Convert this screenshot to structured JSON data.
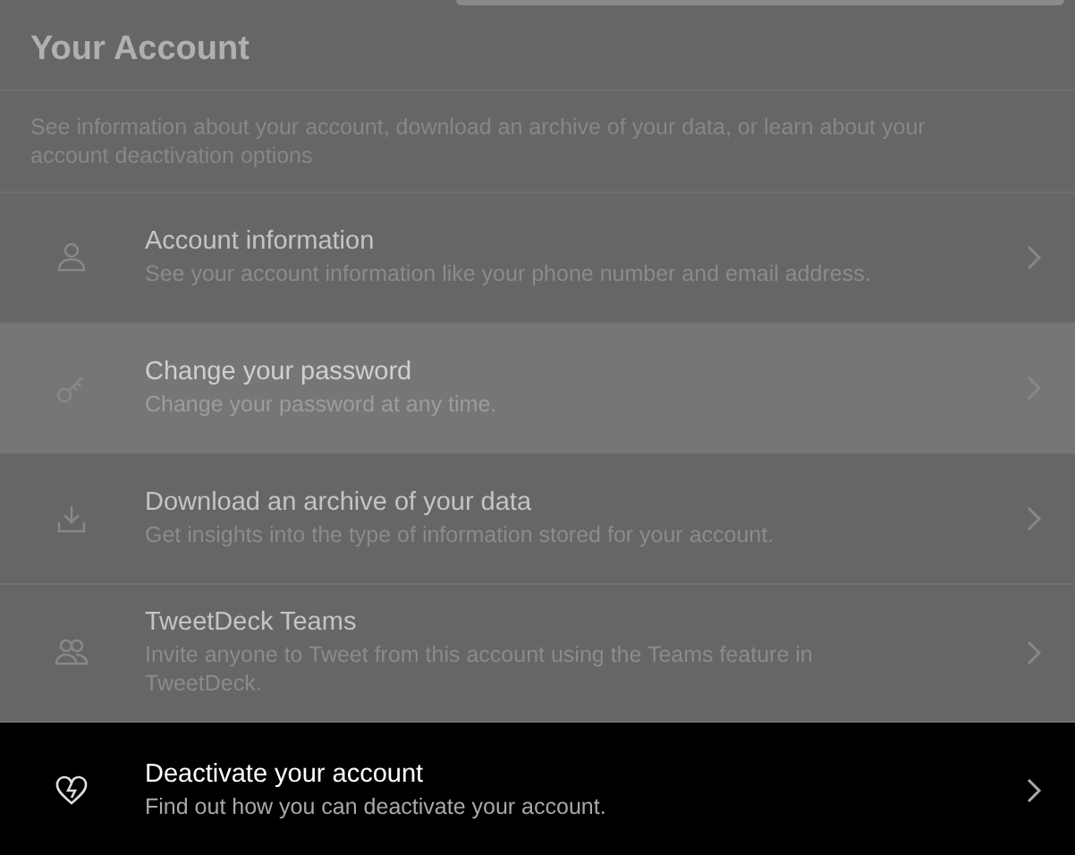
{
  "header": {
    "title": "Your Account",
    "description": "See information about your account, download an archive of your data, or learn about your account deactivation options"
  },
  "items": [
    {
      "title": "Account information",
      "subtitle": "See your account information like your phone number and email address.",
      "hovered": false,
      "selected": false
    },
    {
      "title": "Change your password",
      "subtitle": "Change your password at any time.",
      "hovered": true,
      "selected": false
    },
    {
      "title": "Download an archive of your data",
      "subtitle": "Get insights into the type of information stored for your account.",
      "hovered": false,
      "selected": false
    },
    {
      "title": "TweetDeck Teams",
      "subtitle": "Invite anyone to Tweet from this account using the Teams feature in TweetDeck.",
      "hovered": false,
      "selected": false
    },
    {
      "title": "Deactivate your account",
      "subtitle": "Find out how you can deactivate your account.",
      "hovered": false,
      "selected": true
    }
  ]
}
